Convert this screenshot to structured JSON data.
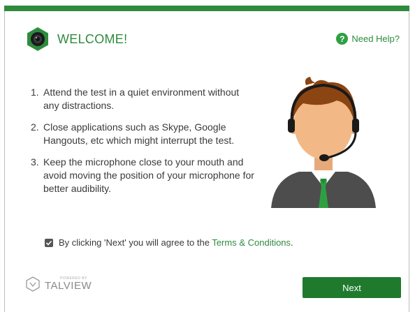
{
  "header": {
    "title": "WELCOME!",
    "help_label": "Need Help?",
    "help_icon": "?"
  },
  "instructions": [
    {
      "num": "1.",
      "text": "Attend the test in a quiet environment without any distractions."
    },
    {
      "num": "2.",
      "text": "Close applications such as Skype, Google Hangouts, etc which might interrupt the test."
    },
    {
      "num": "3.",
      "text": "Keep the microphone close to your mouth and avoid moving the position of your microphone for better audibility."
    }
  ],
  "agreement": {
    "checked": true,
    "text": "By clicking 'Next' you will agree to the ",
    "link": "Terms & Conditions",
    "suffix": "."
  },
  "footer": {
    "powered_by": "POWERED BY",
    "brand": "TALVIEW",
    "next_label": "Next"
  },
  "colors": {
    "accent": "#2e8b3e",
    "button": "#1f7a2e"
  }
}
